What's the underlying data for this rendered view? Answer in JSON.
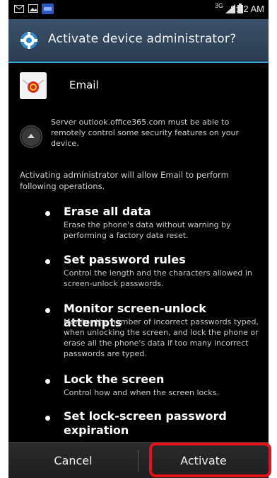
{
  "status_bar": {
    "time": "8:42 AM",
    "icons": [
      "sms-icon",
      "image-icon",
      "app-icon",
      "network-4g-icon",
      "signal-icon",
      "battery-icon"
    ],
    "network_label": "3G"
  },
  "dialog": {
    "title": "Activate device administrator?",
    "title_icon": "gear-icon",
    "app_name": "Email",
    "server_text": "Server outlook.office365.com must be able to remotely control some security features on your device.",
    "intro_text": "Activating administrator will allow Email to perform following operations.",
    "permissions": [
      {
        "title": "Erase all data",
        "description": "Erase the phone's data without warning by performing a factory data reset."
      },
      {
        "title": "Set password rules",
        "description": "Control the length and the characters allowed in screen-unlock passwords."
      },
      {
        "title": "Monitor screen-unlock attempts",
        "description": "Monitor the number of incorrect passwords typed, when unlocking the screen, and lock the phone or erase all the phone's data if too many incorrect passwords are typed."
      },
      {
        "title": "Lock the screen",
        "description": "Control how and when the screen locks."
      },
      {
        "title": "Set lock-screen password expiration",
        "description": ""
      }
    ]
  },
  "buttons": {
    "cancel": "Cancel",
    "activate": "Activate"
  },
  "colors": {
    "highlight": "#e8101b",
    "title_bar": "#34495e",
    "accent_line": "#3aa6d8"
  }
}
